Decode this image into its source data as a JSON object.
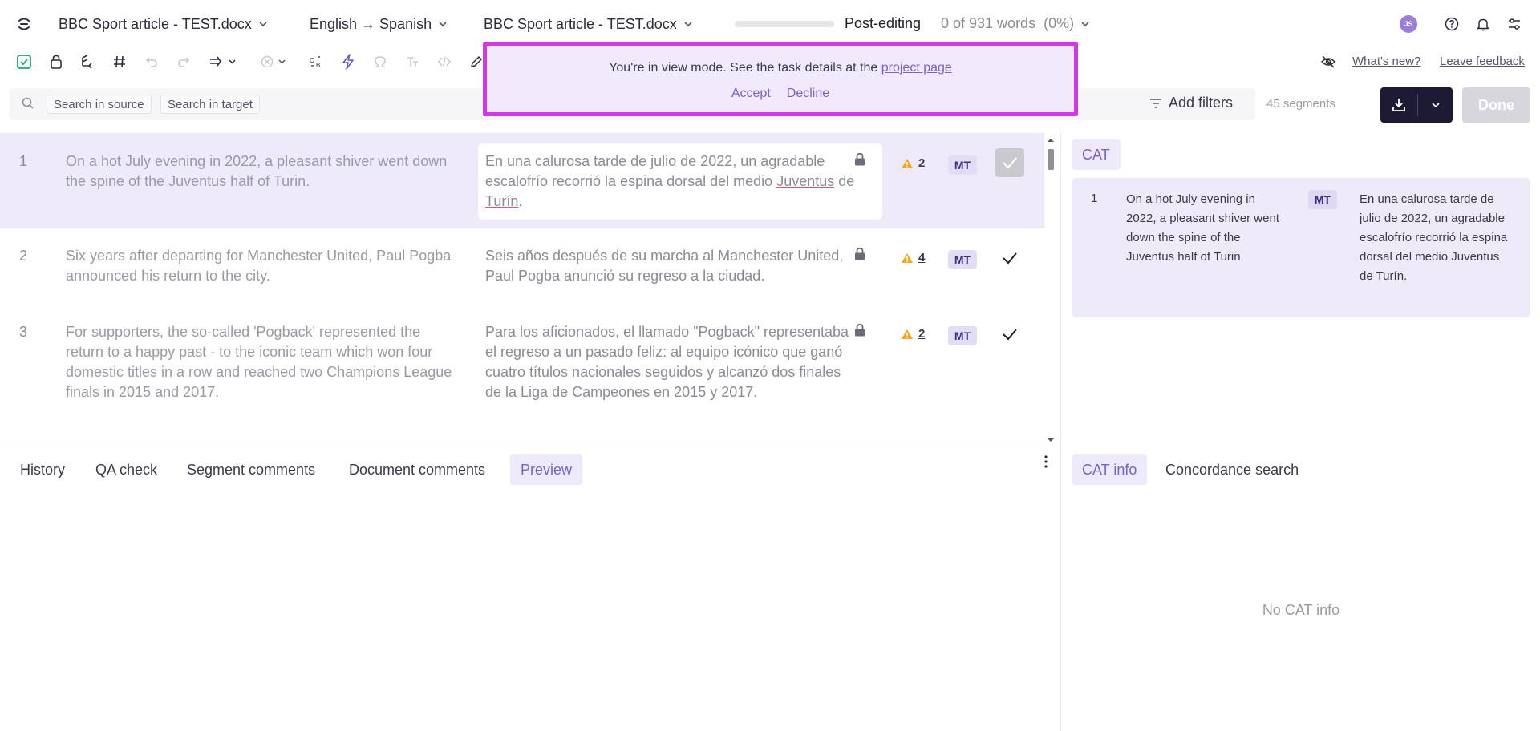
{
  "header": {
    "logo_icon": "logo-icon",
    "file_label": "BBC Sport article - TEST.docx",
    "language_pair": "English → Spanish",
    "task_file_label": "BBC Sport article - TEST.docx",
    "progress": 0,
    "mode_label": "Post-editing",
    "words_status": "0 of 931 words  (0%)",
    "avatar_initials": "JS"
  },
  "toolbar": {
    "whats_new": "What's new?",
    "leave_feedback": "Leave feedback"
  },
  "search": {
    "source_chip": "Search in source",
    "target_chip": "Search in target",
    "add_filters": "Add filters",
    "segment_count": "45 segments",
    "done_label": "Done"
  },
  "banner": {
    "message": "You're in view mode. See the task details at the ",
    "link_text": "project page",
    "accept": "Accept",
    "decline": "Decline"
  },
  "segments": [
    {
      "num": "1",
      "source": "On a hot July evening in 2022, a pleasant shiver went down the spine of the Juventus half of Turin.",
      "target_pre": "En una calurosa tarde de julio de 2022, un agradable escalofrío recorrió la espina dorsal del medio ",
      "target_word1": "Juventus",
      "target_mid": " de ",
      "target_word2": "Turín",
      "target_post": ".",
      "warnings": "2",
      "badge": "MT"
    },
    {
      "num": "2",
      "source": "Six years after departing for Manchester United, Paul Pogba announced his return to the city.",
      "target": "Seis años después de su marcha al Manchester United, Paul Pogba anunció su regreso a la ciudad.",
      "warnings": "4",
      "badge": "MT"
    },
    {
      "num": "3",
      "source": "For supporters, the so-called 'Pogback' represented the return to a happy past - to the iconic team which won four domestic titles in a row and reached two Champions League finals in 2015 and 2017.",
      "target": "Para los aficionados, el llamado \"Pogback\" representaba el regreso a un pasado feliz: al equipo icónico que ganó cuatro títulos nacionales seguidos y alcanzó dos finales de la Liga de Campeones en 2015 y 2017.",
      "warnings": "2",
      "badge": "MT"
    }
  ],
  "bottom_tabs": [
    "History",
    "QA check",
    "Segment comments",
    "Document comments",
    "Preview"
  ],
  "bottom_active_tab": "Preview",
  "cat": {
    "tab_label": "CAT",
    "match": {
      "num": "1",
      "source": "On a hot July evening in 2022, a pleasant shiver went down the spine of the Juventus half of Turin.",
      "badge": "MT",
      "target": "En una calurosa tarde de julio de 2022, un agradable escalofrío recorrió la espina dorsal del medio Juventus de Turín."
    },
    "tabs": [
      "CAT info",
      "Concordance search"
    ],
    "active_tab": "CAT info",
    "empty_message": "No CAT info"
  },
  "colors": {
    "accent": "#7b62c9",
    "banner_border": "#d438e6",
    "active_row": "#efeafa",
    "warning": "#f5a623",
    "primary_button": "#1d1b33"
  }
}
